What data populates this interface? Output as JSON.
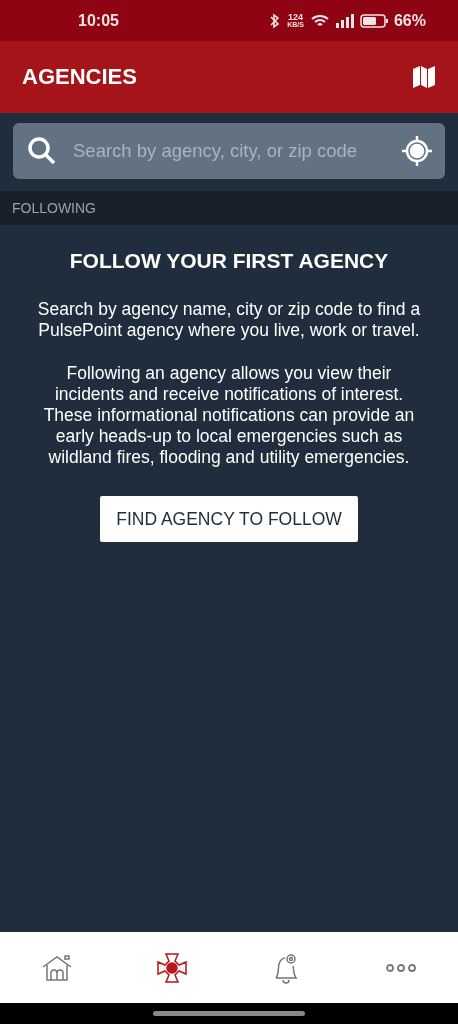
{
  "status_bar": {
    "time": "10:05",
    "speed_value": "124",
    "speed_unit": "KB/S",
    "battery": "66%"
  },
  "header": {
    "title": "AGENCIES"
  },
  "search": {
    "placeholder": "Search by agency, city, or zip code"
  },
  "section": {
    "label": "FOLLOWING"
  },
  "empty_state": {
    "heading": "FOLLOW YOUR FIRST AGENCY",
    "paragraphs": [
      "Search by agency name, city or zip code to find a PulsePoint agency where you live, work or travel.",
      "Following an agency allows you view their incidents and receive notifications of interest. These informational notifications can provide an early heads-up to local emergencies such as wildland fires, flooding and utility emergencies."
    ],
    "button": "FIND AGENCY TO FOLLOW"
  },
  "bottom_nav": [
    {
      "kind": "home",
      "selected": false
    },
    {
      "kind": "agencies",
      "selected": true
    },
    {
      "kind": "alerts",
      "selected": false
    },
    {
      "kind": "more",
      "selected": false
    }
  ]
}
